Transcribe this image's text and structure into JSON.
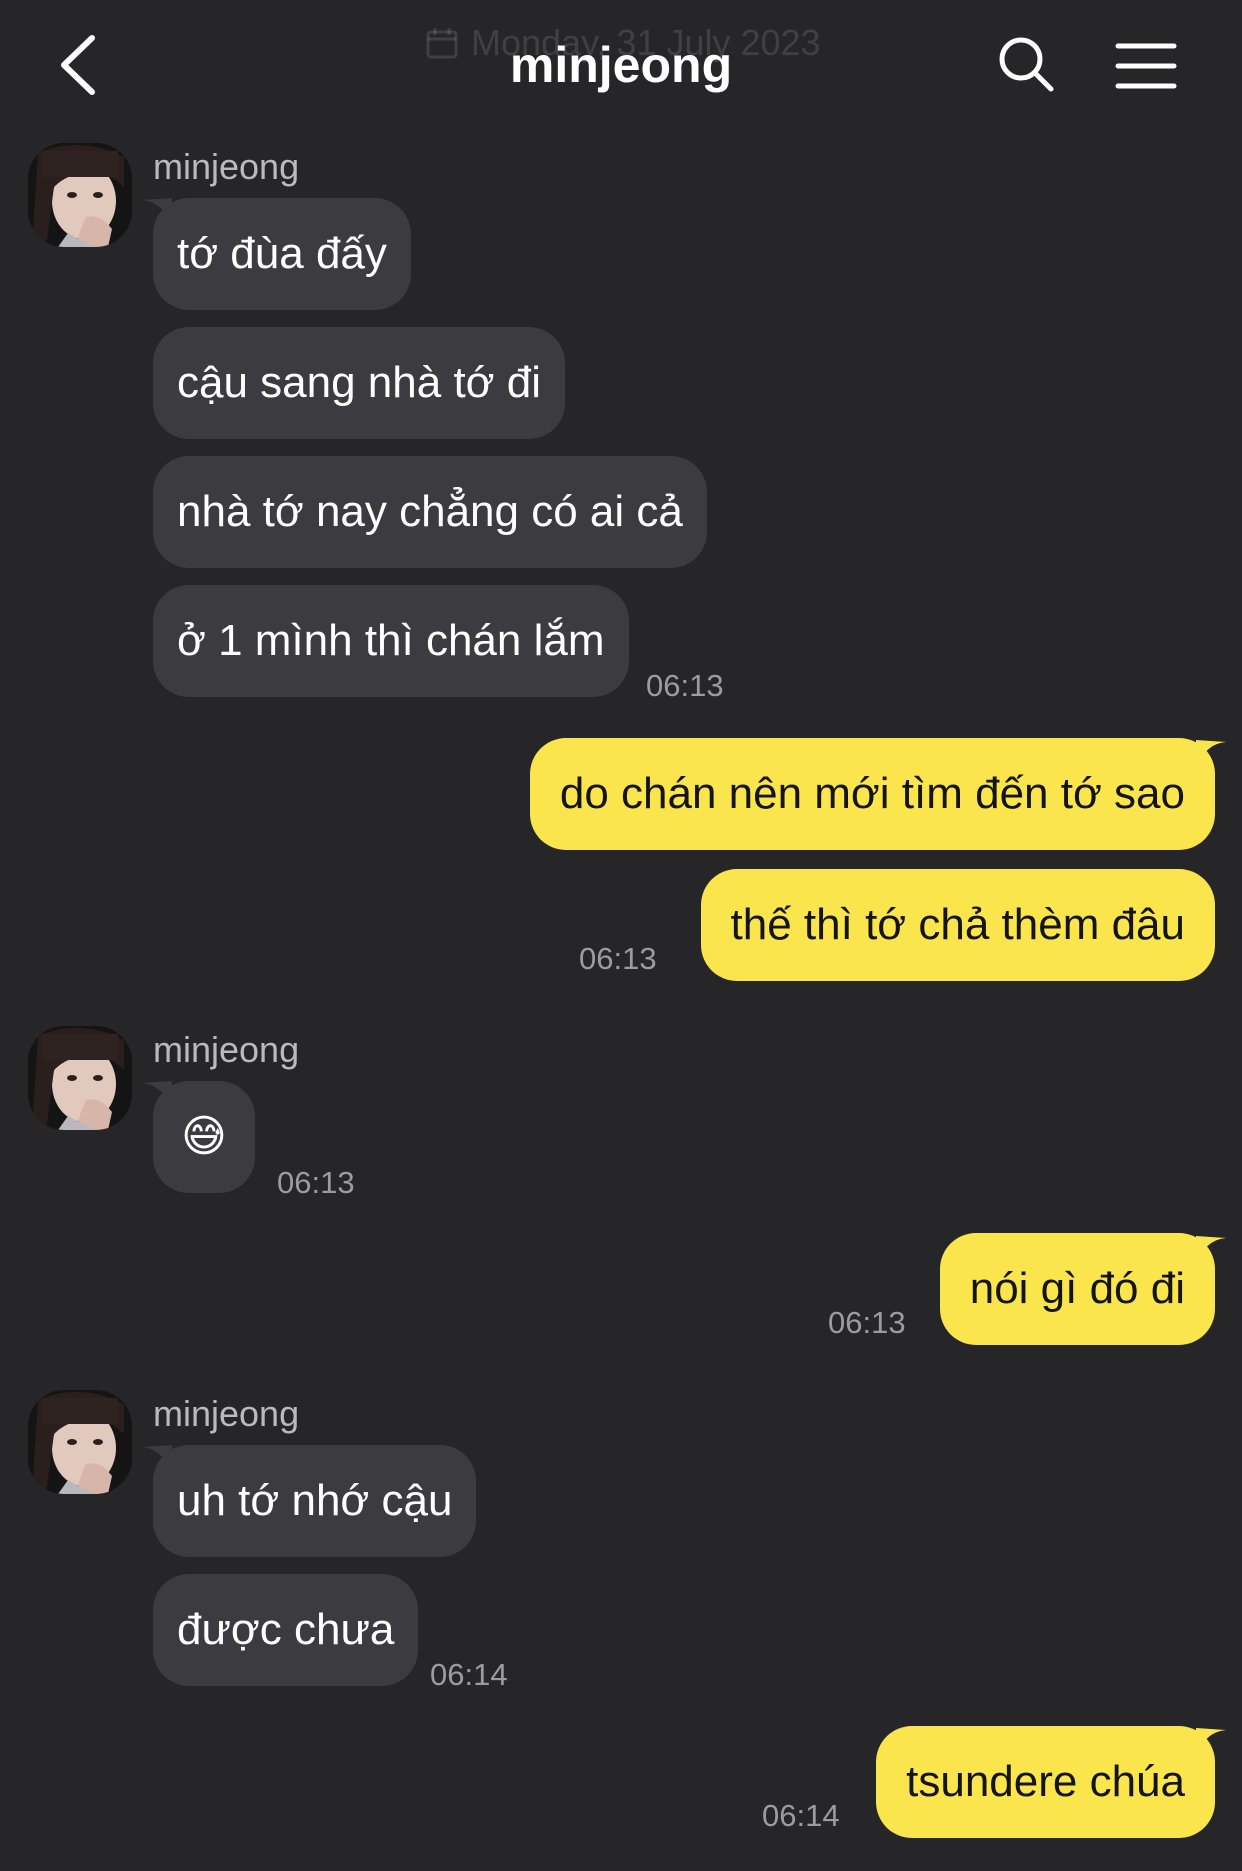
{
  "header": {
    "title": "minjeong",
    "date_label": "Monday, 31 July 2023"
  },
  "icons": {
    "back": "chevron-left-icon",
    "search": "search-icon",
    "menu": "hamburger-menu-icon",
    "calendar": "calendar-icon"
  },
  "colors": {
    "background": "#262629",
    "incoming_bubble": "#3b3b40",
    "outgoing_bubble": "#fae54d",
    "timestamp": "#9b9ba1"
  },
  "conversation": [
    {
      "sender": "minjeong",
      "direction": "incoming",
      "messages": [
        "tớ đùa đấy",
        "cậu sang nhà tớ đi",
        "nhà tớ nay chẳng có ai cả",
        "ở 1 mình thì chán lắm"
      ],
      "time": "06:13"
    },
    {
      "direction": "outgoing",
      "messages": [
        "do chán nên mới tìm đến tớ sao",
        "thế thì tớ chả thèm đâu"
      ],
      "time": "06:13"
    },
    {
      "sender": "minjeong",
      "direction": "incoming",
      "messages": [
        "😅"
      ],
      "time": "06:13"
    },
    {
      "direction": "outgoing",
      "messages": [
        "nói gì đó đi"
      ],
      "time": "06:13"
    },
    {
      "sender": "minjeong",
      "direction": "incoming",
      "messages": [
        "uh tớ nhớ cậu",
        "được chưa"
      ],
      "time": "06:14"
    },
    {
      "direction": "outgoing",
      "messages": [
        "tsundere chúa"
      ],
      "time": "06:14"
    }
  ]
}
